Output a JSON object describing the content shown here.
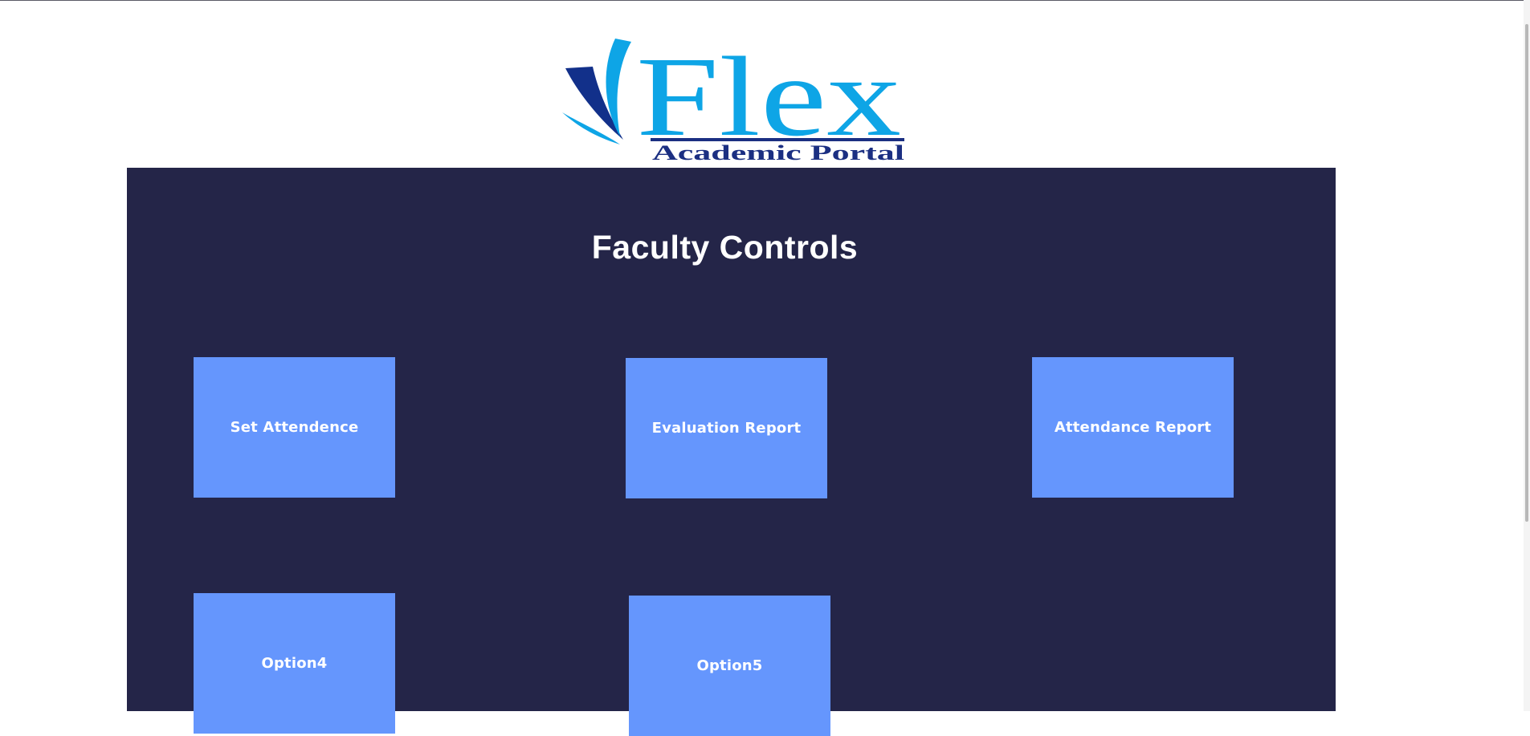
{
  "logo": {
    "wordmark": "Flex",
    "tagline": "Academic Portal",
    "colors": {
      "wordmark": "#0ea5e6",
      "tagline": "#1b2f82",
      "swoosh_dark": "#12308a",
      "swoosh_light": "#0ea5e6"
    }
  },
  "panel": {
    "title": "Faculty Controls",
    "background": "#242548"
  },
  "tiles": [
    {
      "label": "Set Attendence"
    },
    {
      "label": "Evaluation Report"
    },
    {
      "label": "Attendance Report"
    },
    {
      "label": "Option4"
    },
    {
      "label": "Option5"
    }
  ],
  "tile_color": "#6596fd"
}
